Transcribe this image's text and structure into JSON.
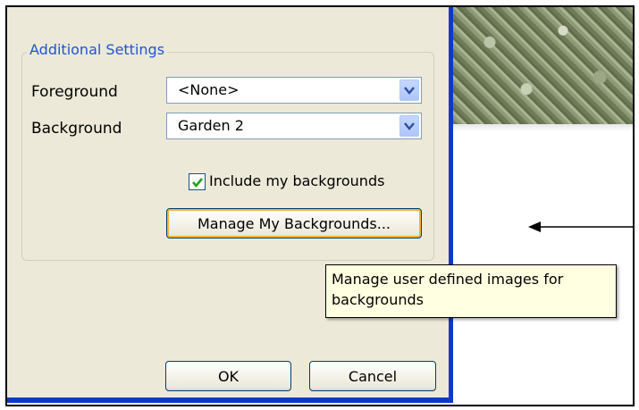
{
  "group": {
    "title": "Additional Settings"
  },
  "foreground": {
    "label": "Foreground",
    "value": "<None>"
  },
  "background": {
    "label": "Background",
    "value": "Garden 2"
  },
  "include_backgrounds": {
    "label": "Include my backgrounds",
    "checked": true
  },
  "manage_button": {
    "label": "Manage My Backgrounds..."
  },
  "tooltip": {
    "line1": "Manage user defined images for",
    "line2": "backgrounds"
  },
  "footer": {
    "ok_label": "OK",
    "cancel_label": "Cancel"
  },
  "colors": {
    "dialog_bg": "#ece9d8",
    "accent_blue": "#0a3bc8",
    "group_title": "#1f54d6",
    "tooltip_bg": "#ffffe1",
    "focus": "#f8b230"
  },
  "icons": {
    "dropdown": "chevron-down-icon",
    "check": "checkmark-icon",
    "arrow": "arrow-left-icon"
  }
}
